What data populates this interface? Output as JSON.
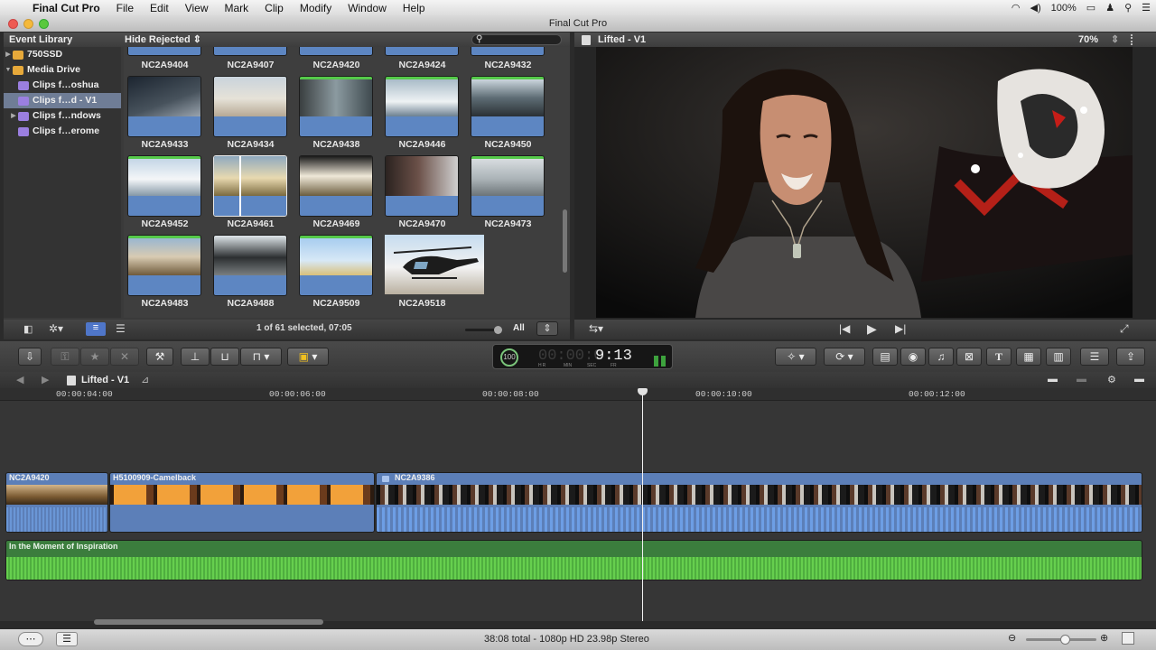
{
  "menubar": {
    "app_name": "Final Cut Pro",
    "items": [
      "File",
      "Edit",
      "View",
      "Mark",
      "Clip",
      "Modify",
      "Window",
      "Help"
    ],
    "battery": "100%"
  },
  "window": {
    "title": "Final Cut Pro"
  },
  "event_library": {
    "header": "Event Library",
    "filter_label": "Hide Rejected",
    "items": [
      {
        "label": "750SSD"
      },
      {
        "label": "Media Drive"
      },
      {
        "label": "Clips f…oshua"
      },
      {
        "label": "Clips f…d - V1"
      },
      {
        "label": "Clips f…ndows"
      },
      {
        "label": "Clips f…erome"
      }
    ],
    "clips_row0": [
      "NC2A9404",
      "NC2A9407",
      "NC2A9420",
      "NC2A9424",
      "NC2A9432"
    ],
    "clips": [
      [
        "NC2A9433",
        "NC2A9434",
        "NC2A9438",
        "NC2A9446",
        "NC2A9450"
      ],
      [
        "NC2A9452",
        "NC2A9461",
        "NC2A9469",
        "NC2A9470",
        "NC2A9473"
      ],
      [
        "NC2A9483",
        "NC2A9488",
        "NC2A9509",
        "NC2A9518"
      ]
    ],
    "selection_status": "1 of 61 selected, 07:05",
    "filter_all": "All"
  },
  "viewer": {
    "title": "Lifted - V1",
    "zoom": "70%"
  },
  "toolbar": {
    "timecode": "9:13",
    "timecode_dim": "00:00:0",
    "timecode_percent": "100",
    "timecode_units": [
      "HR",
      "MIN",
      "SEC",
      "FR"
    ]
  },
  "timeline": {
    "project_name": "Lifted - V1",
    "ruler": [
      "00:00:04:00",
      "00:00:06:00",
      "00:00:08:00",
      "00:00:10:00",
      "00:00:12:00"
    ],
    "clips": [
      {
        "name": "NC2A9420"
      },
      {
        "name": "H5100909-Camelback"
      },
      {
        "name": "NC2A9386"
      }
    ],
    "music": "In the Moment of Inspiration"
  },
  "status": {
    "summary": "38:08 total - 1080p HD 23.98p Stereo"
  }
}
